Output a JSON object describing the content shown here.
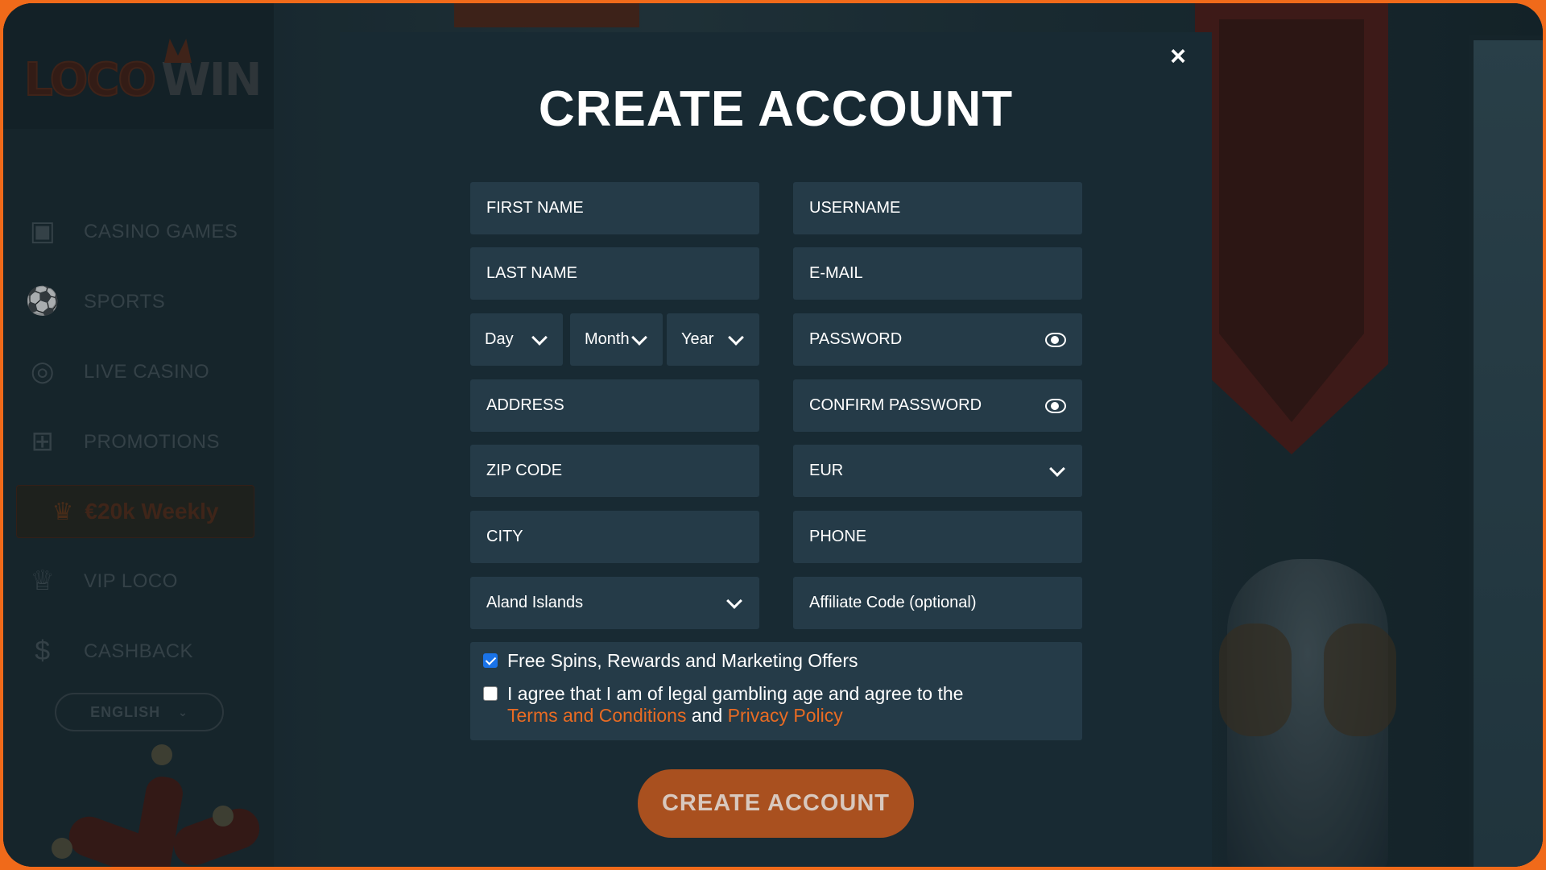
{
  "brand": {
    "logo_left": "LOCO",
    "logo_right": "WIN"
  },
  "sidebar": {
    "items": [
      {
        "label": "CASINO GAMES",
        "icon": "slot-machine-icon"
      },
      {
        "label": "SPORTS",
        "icon": "soccer-ball-icon"
      },
      {
        "label": "LIVE CASINO",
        "icon": "casino-chip-icon"
      },
      {
        "label": "PROMOTIONS",
        "icon": "gift-icon"
      },
      {
        "label": "VIP LOCO",
        "icon": "crown-icon"
      },
      {
        "label": "CASHBACK",
        "icon": "money-bag-icon"
      }
    ],
    "weekly_promo": "€20k Weekly",
    "language": "ENGLISH"
  },
  "modal": {
    "title": "CREATE ACCOUNT",
    "close": "×",
    "fields": {
      "first_name": "FIRST NAME",
      "username": "USERNAME",
      "last_name": "LAST NAME",
      "email": "E-MAIL",
      "dob_day": "Day",
      "dob_month": "Month",
      "dob_year": "Year",
      "password": "PASSWORD",
      "address": "ADDRESS",
      "confirm_password": "CONFIRM PASSWORD",
      "zip_code": "ZIP CODE",
      "currency": "EUR",
      "city": "CITY",
      "phone": "PHONE",
      "country": "Aland Islands",
      "affiliate_code": "Affiliate Code (optional)"
    },
    "consent": {
      "marketing": {
        "label": "Free Spins, Rewards and Marketing Offers",
        "checked": true
      },
      "terms": {
        "label_prefix": "I agree that I am of legal gambling age and agree to the",
        "terms_link": "Terms and Conditions",
        "and": "and",
        "privacy_link": "Privacy Policy",
        "checked": false
      }
    },
    "submit_label": "CREATE ACCOUNT"
  },
  "colors": {
    "accent": "#e86b23",
    "button": "#a9501f",
    "modal_bg": "#182a33",
    "field_bg": "#253b48",
    "checkbox_checked": "#1a73e8"
  }
}
